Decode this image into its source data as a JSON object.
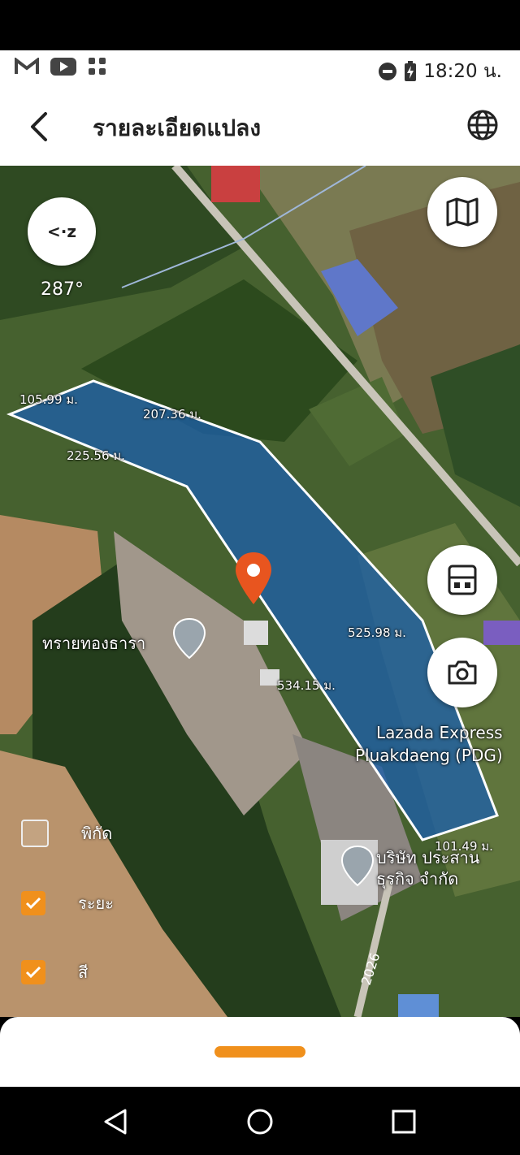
{
  "status_bar": {
    "time": "18:20 น.",
    "left_icons": [
      "gmail-icon",
      "youtube-icon",
      "apps-icon"
    ],
    "right_icons": [
      "do-not-disturb-icon",
      "battery-charging-icon"
    ]
  },
  "app_bar": {
    "title": "รายละเอียดแปลง",
    "back_icon": "back-arrow-icon",
    "globe_icon": "globe-icon"
  },
  "map": {
    "compass_label": "<·z",
    "heading": "287°",
    "measurements": [
      "105.99 ม.",
      "207.36 ม.",
      "225.56 ม.",
      "525.98 ม.",
      "534.15 ม.",
      "101.49 ม."
    ],
    "places": [
      "ทรายทองธารา",
      "Lazada Express",
      "Pluakdaeng (PDG)",
      "บริษัท ประสาน",
      "ธุรกิจ จำกัด"
    ],
    "road_label": "2026",
    "controls": [
      "map-layers-icon",
      "calculator-icon",
      "camera-icon"
    ],
    "layer_toggles": [
      {
        "label": "พิกัด",
        "checked": false
      },
      {
        "label": "ระยะ",
        "checked": true
      },
      {
        "label": "สี",
        "checked": true
      }
    ],
    "colors": {
      "parcel_fill": "#1e5fa8",
      "parcel_stroke": "#ffffff",
      "pin": "#e8551f",
      "toggle_checked": "#f0901c"
    }
  },
  "bottom_sheet": {
    "handle_color": "#f0901c"
  },
  "nav_bar": {
    "icons": [
      "back-triangle-icon",
      "home-circle-icon",
      "recents-square-icon"
    ]
  }
}
